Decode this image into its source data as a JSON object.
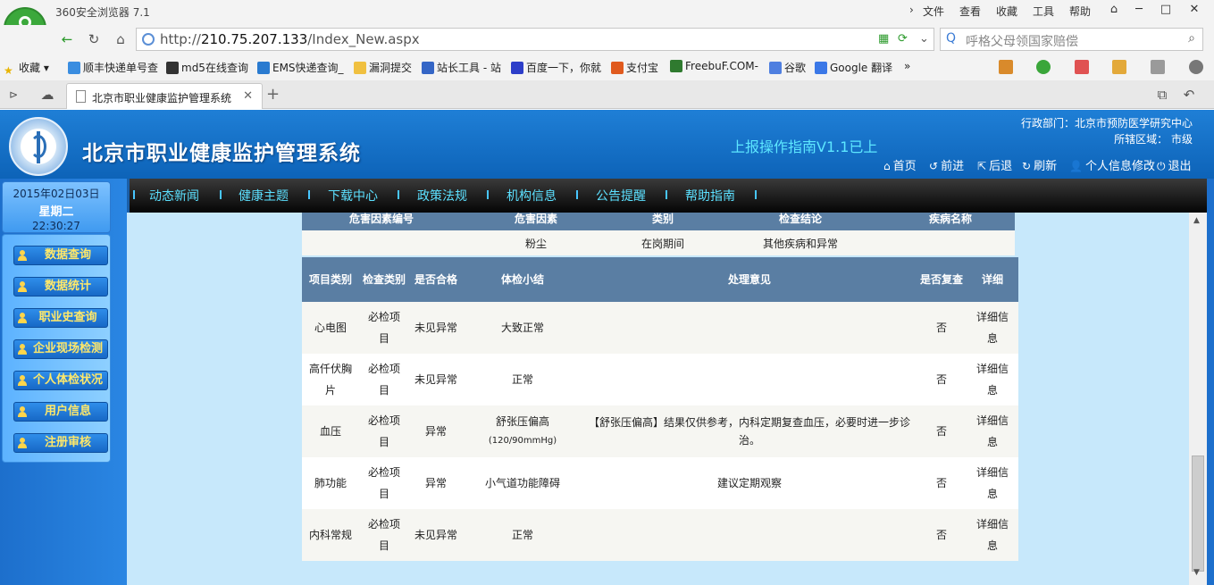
{
  "browser": {
    "app_title": "360安全浏览器 7.1",
    "menus": [
      "文件",
      "查看",
      "收藏",
      "工具",
      "帮助"
    ],
    "url_prefix": "http://",
    "url_host": "210.75.207.133",
    "url_path": "/Index_New.aspx",
    "search_placeholder": "呼格父母领国家赔偿",
    "favorites": [
      "收藏",
      "顺丰快递单号查",
      "md5在线查询",
      "EMS快递查询_",
      "漏洞提交",
      "站长工具 - 站",
      "百度一下，你就",
      "支付宝",
      "FreebuF.COM-",
      "谷歌",
      "Google 翻译"
    ],
    "more_favorites": "»",
    "tab_title": "北京市职业健康监护管理系统",
    "new_tab": "+"
  },
  "header": {
    "site_title": "北京市职业健康监护管理系统",
    "marquee": "上报操作指南V1.1已上",
    "org": "行政部门：北京市预防医学研究中心",
    "region": "所辖区域：  市级",
    "nav": [
      "首页",
      "前进",
      "后退",
      "刷新",
      "个人信息修改",
      "退出"
    ]
  },
  "sidebar": {
    "date": "2015年02日03日",
    "weekday": "星期二",
    "time": "22:30:27",
    "items": [
      "数据查询",
      "数据统计",
      "职业史查询",
      "企业现场检测",
      "个人体检状况",
      "用户信息",
      "注册审核"
    ]
  },
  "main_nav": [
    "动态新闻",
    "健康主题",
    "下载中心",
    "政策法规",
    "机构信息",
    "公告提醒",
    "帮助指南"
  ],
  "hazard_table": {
    "headers": [
      "危害因素编号",
      "危害因素",
      "类别",
      "检查结论",
      "疾病名称"
    ],
    "row": [
      "",
      "粉尘",
      "在岗期间",
      "其他疾病和异常",
      ""
    ]
  },
  "exam_table": {
    "headers": [
      "项目类别",
      "检查类别",
      "是否合格",
      "体检小结",
      "处理意见",
      "是否复查",
      "详细"
    ],
    "rows": [
      {
        "cat": "心电图",
        "type": "必检项目",
        "ok": "未见异常",
        "summary": "大致正常",
        "summary2": "",
        "advice": "",
        "recheck": "否",
        "detail": "详细信息"
      },
      {
        "cat": "高仟伏胸片",
        "type": "必检项目",
        "ok": "未见异常",
        "summary": "正常",
        "summary2": "",
        "advice": "",
        "recheck": "否",
        "detail": "详细信息"
      },
      {
        "cat": "血压",
        "type": "必检项目",
        "ok": "异常",
        "summary": "舒张压偏高",
        "summary2": "(120/90mmHg)",
        "advice": "【舒张压偏高】结果仅供参考，内科定期复查血压，必要时进一步诊治。",
        "recheck": "否",
        "detail": "详细信息"
      },
      {
        "cat": "肺功能",
        "type": "必检项目",
        "ok": "异常",
        "summary": "小气道功能障碍",
        "summary2": "",
        "advice": "建议定期观察",
        "recheck": "否",
        "detail": "详细信息"
      },
      {
        "cat": "内科常规",
        "type": "必检项目",
        "ok": "未见异常",
        "summary": "正常",
        "summary2": "",
        "advice": "",
        "recheck": "否",
        "detail": "详细信息"
      }
    ]
  }
}
